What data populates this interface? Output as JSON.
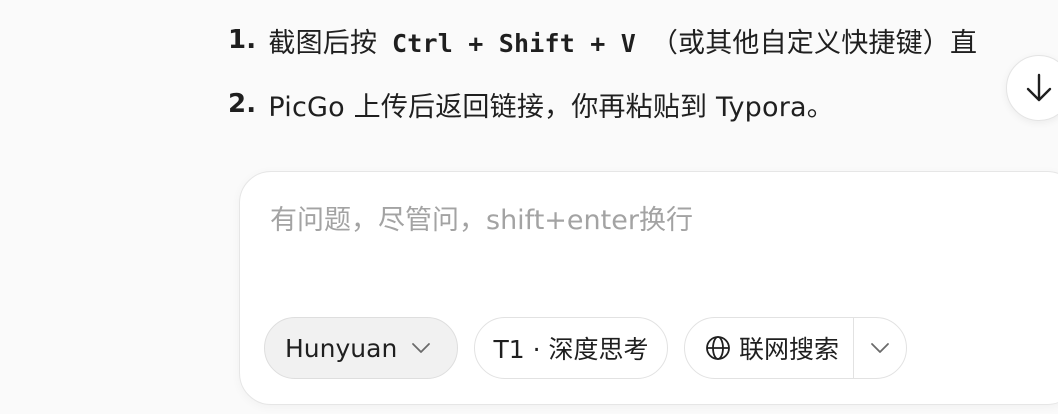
{
  "steps": [
    {
      "number": "1.",
      "prefix": "截图后按",
      "shortcut": "Ctrl + Shift + V",
      "suffix": "（或其他自定义快捷键）直"
    },
    {
      "number": "2.",
      "text": "PicGo 上传后返回链接，你再粘贴到 Typora。"
    }
  ],
  "scroll_button": {
    "icon": "arrow-down-icon"
  },
  "composer": {
    "placeholder": "有问题，尽管问，shift+enter换行",
    "value": "",
    "model_selector": {
      "label": "Hunyuan",
      "icon": "chevron-down-icon"
    },
    "deep_think": {
      "label": "T1 · 深度思考"
    },
    "web_search": {
      "label": "联网搜索",
      "icon": "globe-icon",
      "dropdown_icon": "chevron-down-icon"
    }
  },
  "colors": {
    "background": "#fafafa",
    "text": "#1f1f1f",
    "placeholder": "#a3a3a3",
    "border": "#e2e2e2",
    "model_chip_bg": "#f1f1f1"
  }
}
